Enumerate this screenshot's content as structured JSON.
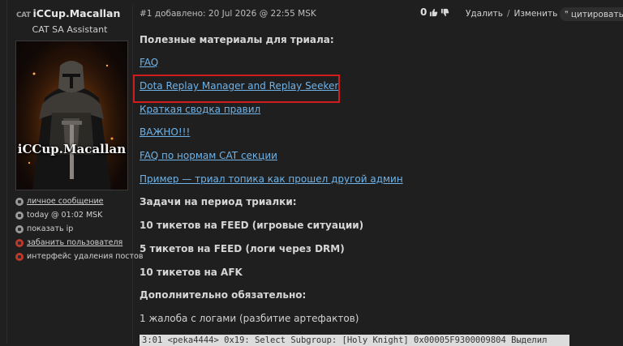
{
  "user": {
    "prefix": "CAT",
    "name": "iCCup.Macallan",
    "role": "CAT SA Assistant",
    "avatar_text": "iCCup.Macallan",
    "actions": [
      {
        "label": "личное сообщение",
        "icon": "mail-icon",
        "link": true
      },
      {
        "label": "today @ 01:02 MSK",
        "icon": "clock-icon",
        "link": false
      },
      {
        "label": "показать ip",
        "icon": "monitor-icon",
        "link": false
      },
      {
        "label": "забанить пользователя",
        "icon": "ban-icon",
        "link": true
      },
      {
        "label": "интерфейс удаления постов",
        "icon": "delete-icon",
        "link": false
      }
    ]
  },
  "post": {
    "meta": "#1 добавлено: 20 Jul 2026 @ 22:55 MSK",
    "votes": "0",
    "delete_label": "Удалить",
    "separator": "/",
    "edit_label": "Изменить",
    "quote_label": "цитировать",
    "quote_icon": "quote-icon"
  },
  "content": {
    "heading": "Полезные материалы для триала:",
    "links": [
      "FAQ",
      "Dota Replay Manager and Replay Seeker",
      "Краткая сводка правил",
      "ВАЖНО!!!",
      "FAQ по нормам CAT секции",
      "Пример — триал топика как прошел другой админ"
    ],
    "tasks_heading": "Задачи на период триалки:",
    "task_1": "10 тикетов на FEED (игровые ситуации)",
    "task_2": "5 тикетов на FEED (логи через DRM)",
    "task_3": "10 тикетов на AFK",
    "extra_heading": "Дополнительно обязательно:",
    "extra_1": "1 жалоба с логами (разбитие артефактов)",
    "log_line": "3:01 <peka4444> 0x19: Select Subgroup: [Holy Knight] 0x00005F9300009804 Выделил"
  },
  "colors": {
    "background": "#1f1f1f",
    "link": "#6fb3e8",
    "highlight_border": "#d01c1c"
  }
}
